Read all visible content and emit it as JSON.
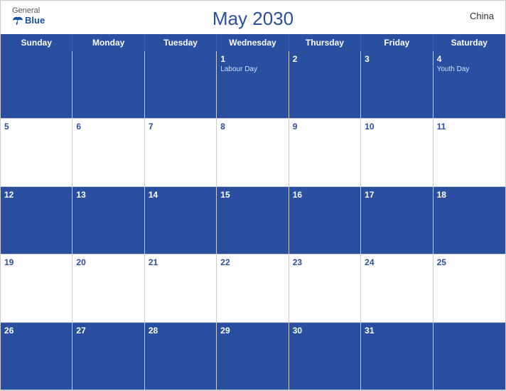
{
  "header": {
    "title": "May 2030",
    "country": "China",
    "logo": {
      "general": "General",
      "blue": "Blue"
    }
  },
  "days": [
    "Sunday",
    "Monday",
    "Tuesday",
    "Wednesday",
    "Thursday",
    "Friday",
    "Saturday"
  ],
  "weeks": [
    [
      {
        "date": "",
        "event": "",
        "row": "blue"
      },
      {
        "date": "",
        "event": "",
        "row": "blue"
      },
      {
        "date": "",
        "event": "",
        "row": "blue"
      },
      {
        "date": "1",
        "event": "Labour Day",
        "row": "blue"
      },
      {
        "date": "2",
        "event": "",
        "row": "blue"
      },
      {
        "date": "3",
        "event": "",
        "row": "blue"
      },
      {
        "date": "4",
        "event": "Youth Day",
        "row": "blue"
      }
    ],
    [
      {
        "date": "5",
        "event": "",
        "row": "white"
      },
      {
        "date": "6",
        "event": "",
        "row": "white"
      },
      {
        "date": "7",
        "event": "",
        "row": "white"
      },
      {
        "date": "8",
        "event": "",
        "row": "white"
      },
      {
        "date": "9",
        "event": "",
        "row": "white"
      },
      {
        "date": "10",
        "event": "",
        "row": "white"
      },
      {
        "date": "11",
        "event": "",
        "row": "white"
      }
    ],
    [
      {
        "date": "12",
        "event": "",
        "row": "blue"
      },
      {
        "date": "13",
        "event": "",
        "row": "blue"
      },
      {
        "date": "14",
        "event": "",
        "row": "blue"
      },
      {
        "date": "15",
        "event": "",
        "row": "blue"
      },
      {
        "date": "16",
        "event": "",
        "row": "blue"
      },
      {
        "date": "17",
        "event": "",
        "row": "blue"
      },
      {
        "date": "18",
        "event": "",
        "row": "blue"
      }
    ],
    [
      {
        "date": "19",
        "event": "",
        "row": "white"
      },
      {
        "date": "20",
        "event": "",
        "row": "white"
      },
      {
        "date": "21",
        "event": "",
        "row": "white"
      },
      {
        "date": "22",
        "event": "",
        "row": "white"
      },
      {
        "date": "23",
        "event": "",
        "row": "white"
      },
      {
        "date": "24",
        "event": "",
        "row": "white"
      },
      {
        "date": "25",
        "event": "",
        "row": "white"
      }
    ],
    [
      {
        "date": "26",
        "event": "",
        "row": "blue"
      },
      {
        "date": "27",
        "event": "",
        "row": "blue"
      },
      {
        "date": "28",
        "event": "",
        "row": "blue"
      },
      {
        "date": "29",
        "event": "",
        "row": "blue"
      },
      {
        "date": "30",
        "event": "",
        "row": "blue"
      },
      {
        "date": "31",
        "event": "",
        "row": "blue"
      },
      {
        "date": "",
        "event": "",
        "row": "blue"
      }
    ]
  ]
}
